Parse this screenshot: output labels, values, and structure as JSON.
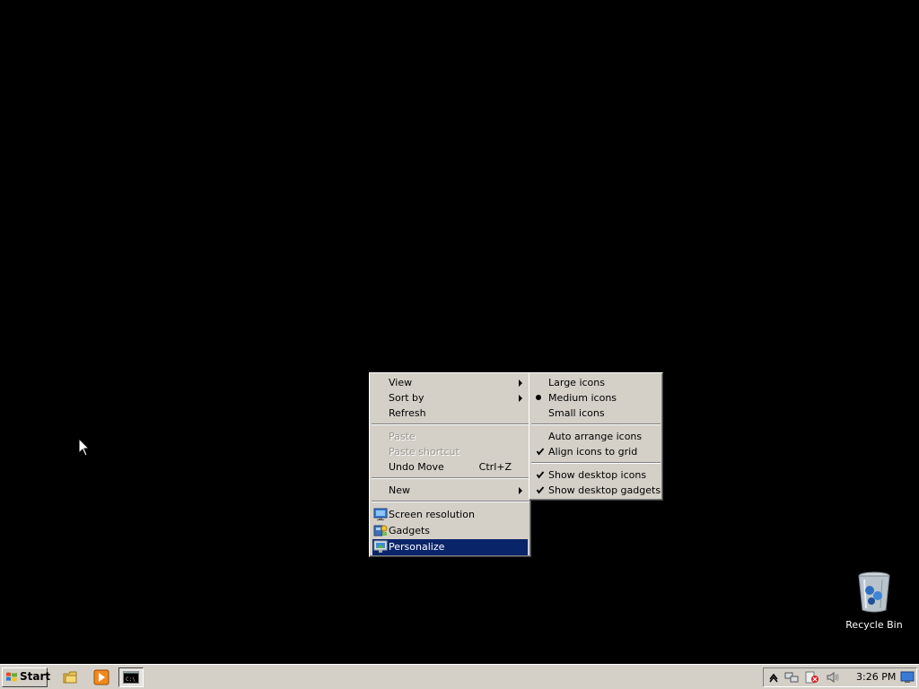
{
  "desktop": {
    "recycle_bin_label": "Recycle Bin"
  },
  "context_menu": {
    "items": [
      {
        "label": "View",
        "submenu": true
      },
      {
        "label": "Sort by",
        "submenu": true
      },
      {
        "label": "Refresh"
      },
      {
        "label": "Paste",
        "disabled": true
      },
      {
        "label": "Paste shortcut",
        "disabled": true
      },
      {
        "label": "Undo Move",
        "shortcut": "Ctrl+Z"
      },
      {
        "label": "New",
        "submenu": true
      },
      {
        "label": "Screen resolution",
        "icon": "screen-resolution-icon"
      },
      {
        "label": "Gadgets",
        "icon": "gadgets-icon"
      },
      {
        "label": "Personalize",
        "icon": "personalize-icon",
        "selected": true
      }
    ]
  },
  "view_submenu": {
    "items": [
      {
        "label": "Large icons"
      },
      {
        "label": "Medium icons",
        "radio_selected": true
      },
      {
        "label": "Small icons"
      },
      {
        "label": "Auto arrange icons"
      },
      {
        "label": "Align icons to grid",
        "checked": true
      },
      {
        "label": "Show desktop icons",
        "checked": true
      },
      {
        "label": "Show desktop gadgets",
        "checked": true
      }
    ]
  },
  "taskbar": {
    "start_label": "Start",
    "clock": "3:26 PM",
    "accent": "#0a246a"
  }
}
